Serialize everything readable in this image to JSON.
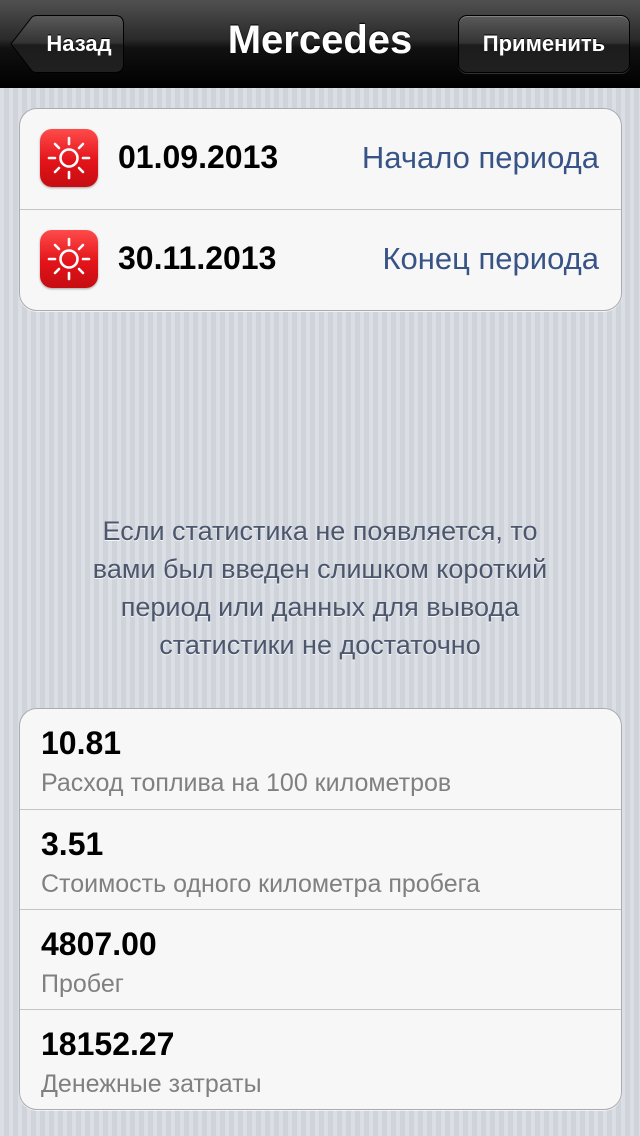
{
  "navbar": {
    "title": "Mercedes",
    "back_label": "Назад",
    "apply_label": "Применить"
  },
  "period": {
    "start": {
      "date": "01.09.2013",
      "label": "Начало периода",
      "icon": "sun-icon"
    },
    "end": {
      "date": "30.11.2013",
      "label": "Конец периода",
      "icon": "sun-icon"
    }
  },
  "info": {
    "lines": [
      "Если статистика не появляется, то",
      "вами был введен слишком короткий",
      "период или данных для вывода",
      "статистики не достаточно"
    ]
  },
  "stats": [
    {
      "value": "10.81",
      "label": "Расход топлива на 100 километров"
    },
    {
      "value": "3.51",
      "label": "Стоимость одного километра пробега"
    },
    {
      "value": "4807.00",
      "label": "Пробег"
    },
    {
      "value": "18152.27",
      "label": "Денежные затраты"
    }
  ],
  "colors": {
    "accent_red": "#e3141a",
    "label_blue": "#385487",
    "background": "#d3d7de"
  }
}
